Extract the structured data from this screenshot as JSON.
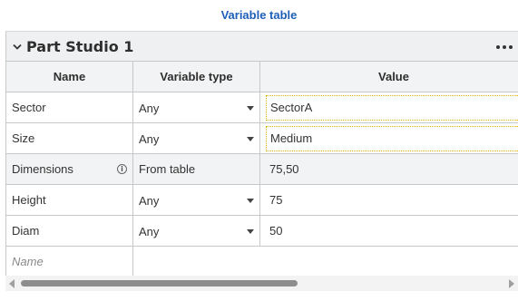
{
  "header": {
    "title": "Variable table"
  },
  "section": {
    "title": "Part Studio 1"
  },
  "table": {
    "columns": [
      "Name",
      "Variable type",
      "Value"
    ],
    "rows": [
      {
        "name": "Sector",
        "type": "Any",
        "value": "SectorA"
      },
      {
        "name": "Size",
        "type": "Any",
        "value": "Medium"
      },
      {
        "name": "Dimensions",
        "type": "From table",
        "value": "75,50"
      },
      {
        "name": "Height",
        "type": "Any",
        "value": "75"
      },
      {
        "name": "Diam",
        "type": "Any",
        "value": "50"
      }
    ],
    "new_row_placeholder": "Name"
  },
  "colors": {
    "accent": "#1f5fb8",
    "highlight_border": "#e0b100",
    "header_bg": "#f2f3f4"
  },
  "icons": {
    "collapse": "chevron-down-icon",
    "more": "more-horizontal-icon",
    "info": "info-icon",
    "dropdown": "caret-down-icon"
  }
}
